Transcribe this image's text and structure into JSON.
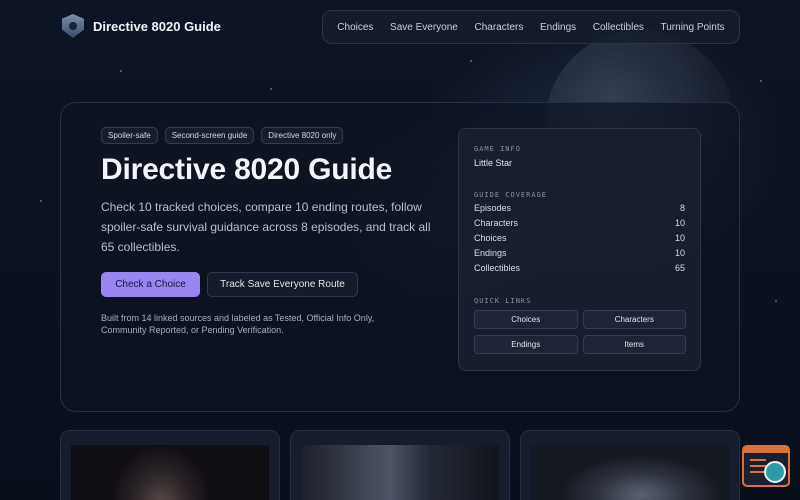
{
  "site": {
    "title": "Directive 8020 Guide"
  },
  "nav": [
    "Choices",
    "Save Everyone",
    "Characters",
    "Endings",
    "Collectibles",
    "Turning Points"
  ],
  "hero": {
    "tags": [
      "Spoiler-safe",
      "Second-screen guide",
      "Directive 8020 only"
    ],
    "title": "Directive 8020 Guide",
    "description": "Check 10 tracked choices, compare 10 ending routes, follow spoiler-safe survival guidance across 8 episodes, and track all 65 collectibles.",
    "primary_button": "Check a Choice",
    "secondary_button": "Track Save Everyone Route",
    "note": "Built from 14 linked sources and labeled as Tested, Official Info Only, Community Reported, or Pending Verification."
  },
  "info": {
    "game_info_label": "GAME INFO",
    "game_info_value": "Little Star",
    "coverage_label": "GUIDE COVERAGE",
    "coverage": [
      {
        "label": "Episodes",
        "value": "8"
      },
      {
        "label": "Characters",
        "value": "10"
      },
      {
        "label": "Choices",
        "value": "10"
      },
      {
        "label": "Endings",
        "value": "10"
      },
      {
        "label": "Collectibles",
        "value": "65"
      }
    ],
    "quick_links_label": "QUICK LINKS",
    "quick_links": [
      "Choices",
      "Characters",
      "Endings",
      "Items"
    ]
  },
  "colors": {
    "accent": "#9a86f3",
    "widget": "#d9733a"
  },
  "icons": {
    "logo": "shield-emblem-icon",
    "widget": "search-list-icon"
  }
}
